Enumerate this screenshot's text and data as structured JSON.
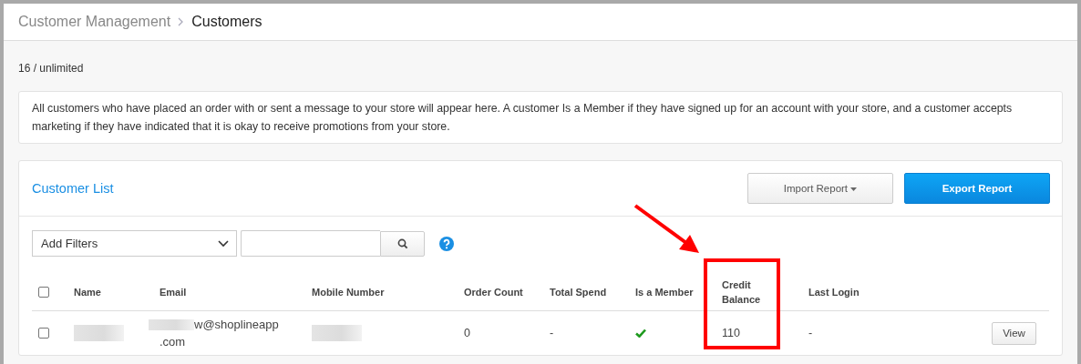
{
  "breadcrumb": [
    {
      "label": "Customer Management",
      "current": false
    },
    {
      "label": "Customers",
      "current": true
    }
  ],
  "quota": "16 / unlimited",
  "notice": "All customers who have placed an order with or sent a message to your store will appear here. A customer Is a Member if they have signed up for an account with your store, and a customer accepts marketing if they have indicated that it is okay to receive promotions from your store.",
  "customer_list": {
    "title": "Customer List",
    "buttons": [
      {
        "label": "Import Report",
        "kind": "dropdown"
      },
      {
        "label": "Export Report",
        "kind": "primary"
      }
    ],
    "filter": {
      "label": "Add Filters"
    },
    "header_checkbox": {
      "checked": false
    },
    "columns": [
      {
        "label": "Name",
        "highlighted": false
      },
      {
        "label": "Email",
        "highlighted": false
      },
      {
        "label": "Mobile Number",
        "highlighted": false
      },
      {
        "label": "Order Count",
        "highlighted": false
      },
      {
        "label": "Total Spend",
        "highlighted": false
      },
      {
        "label": "Is a Member",
        "highlighted": false
      },
      {
        "label": "Credit Balance",
        "highlighted": true
      },
      {
        "label": "Last Login",
        "highlighted": false
      }
    ],
    "rows": [
      {
        "checked": false,
        "action": "View",
        "cells": [
          {
            "kind": "redacted"
          },
          {
            "kind": "partly_redacted",
            "lines": [
              "w@shoplineapp",
              ".com"
            ]
          },
          {
            "kind": "redacted"
          },
          {
            "kind": "text",
            "text": "0"
          },
          {
            "kind": "text",
            "text": "-"
          },
          {
            "kind": "check",
            "on": true
          },
          {
            "kind": "text",
            "text": "110"
          },
          {
            "kind": "text",
            "text": "-"
          }
        ]
      }
    ]
  }
}
